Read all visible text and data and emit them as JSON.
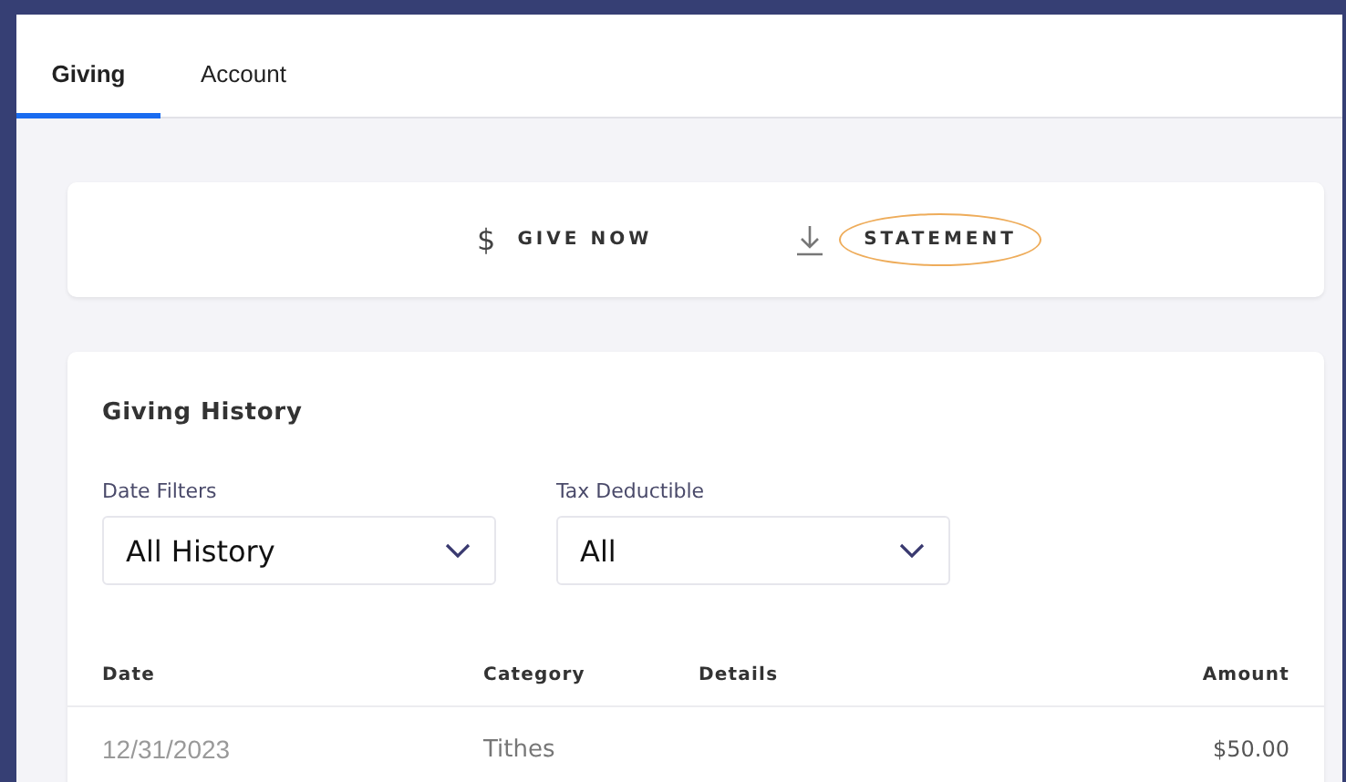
{
  "tabs": [
    {
      "label": "Giving",
      "selected": true
    },
    {
      "label": "Account",
      "selected": false
    }
  ],
  "actions": [
    {
      "kind": "give",
      "icon": "$",
      "label": "GIVE NOW",
      "highlighted": false
    },
    {
      "kind": "download",
      "label": "STATEMENT",
      "highlighted": true
    }
  ],
  "history": {
    "title": "Giving History",
    "filters": [
      {
        "label": "Date Filters",
        "value": "All History"
      },
      {
        "label": "Tax Deductible",
        "value": "All"
      }
    ],
    "columns": [
      "Date",
      "Category",
      "Details",
      "Amount"
    ],
    "rows": [
      {
        "date": "12/31/2023",
        "category": "Tithes",
        "amount": "$50.00"
      }
    ]
  }
}
